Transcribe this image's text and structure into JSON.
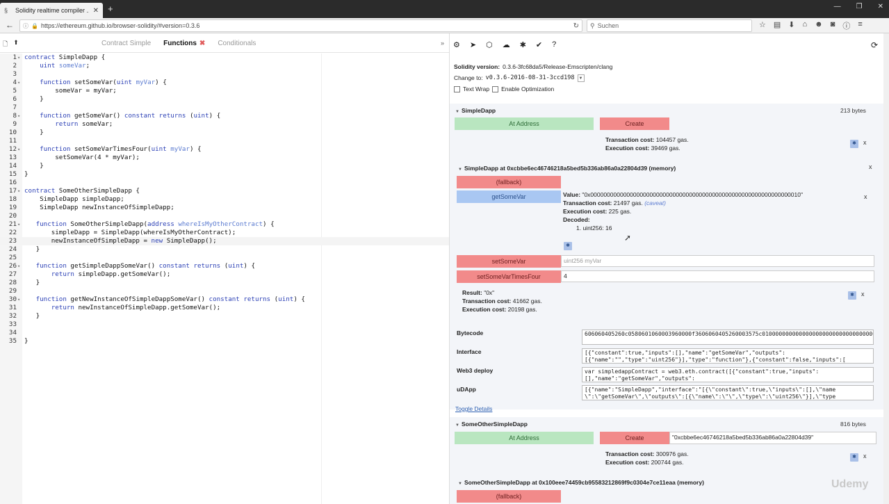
{
  "browser": {
    "tab_title": "Solidity realtime compiler ...",
    "url": "https://ethereum.github.io/browser-solidity/#version=0.3.6",
    "search_placeholder": "Suchen"
  },
  "editor": {
    "tabs": [
      {
        "label": "Contract Simple"
      },
      {
        "label": "Functions",
        "close": "✖"
      },
      {
        "label": "Conditionals"
      }
    ],
    "lines": [
      {
        "n": "1",
        "t": "contract SimpleDapp {"
      },
      {
        "n": "2",
        "t": "    uint someVar;"
      },
      {
        "n": "3",
        "t": ""
      },
      {
        "n": "4",
        "t": "    function setSomeVar(uint myVar) {"
      },
      {
        "n": "5",
        "t": "        someVar = myVar;"
      },
      {
        "n": "6",
        "t": "    }"
      },
      {
        "n": "7",
        "t": ""
      },
      {
        "n": "8",
        "t": "    function getSomeVar() constant returns (uint) {"
      },
      {
        "n": "9",
        "t": "        return someVar;"
      },
      {
        "n": "10",
        "t": "    }"
      },
      {
        "n": "11",
        "t": ""
      },
      {
        "n": "12",
        "t": "    function setSomeVarTimesFour(uint myVar) {"
      },
      {
        "n": "13",
        "t": "        setSomeVar(4 * myVar);"
      },
      {
        "n": "14",
        "t": "    }"
      },
      {
        "n": "15",
        "t": "}"
      },
      {
        "n": "16",
        "t": ""
      },
      {
        "n": "17",
        "t": "contract SomeOtherSimpleDapp {"
      },
      {
        "n": "18",
        "t": "    SimpleDapp simpleDapp;"
      },
      {
        "n": "19",
        "t": "    SimpleDapp newInstanceOfSimpleDapp;"
      },
      {
        "n": "20",
        "t": ""
      },
      {
        "n": "21",
        "t": "   function SomeOtherSimpleDapp(address whereIsMyOtherContract) {"
      },
      {
        "n": "22",
        "t": "       simpleDapp = SimpleDapp(whereIsMyOtherContract);"
      },
      {
        "n": "23",
        "t": "       newInstanceOfSimpleDapp = new SimpleDapp();"
      },
      {
        "n": "24",
        "t": "   }"
      },
      {
        "n": "25",
        "t": ""
      },
      {
        "n": "26",
        "t": "   function getSimpleDappSomeVar() constant returns (uint) {"
      },
      {
        "n": "27",
        "t": "       return simpleDapp.getSomeVar();"
      },
      {
        "n": "28",
        "t": "   }"
      },
      {
        "n": "29",
        "t": ""
      },
      {
        "n": "30",
        "t": "   function getNewInstanceOfSimpleDappSomeVar() constant returns (uint) {"
      },
      {
        "n": "31",
        "t": "       return newInstanceOfSimpleDapp.getSomeVar();"
      },
      {
        "n": "32",
        "t": "   }"
      },
      {
        "n": "33",
        "t": ""
      },
      {
        "n": "34",
        "t": ""
      },
      {
        "n": "35",
        "t": "}"
      }
    ]
  },
  "panel": {
    "solidity_version_label": "Solidity version:",
    "solidity_version": "0.3.6-3fc68da5/Release-Emscripten/clang",
    "change_to_label": "Change to:",
    "change_to_value": "v0.3.6-2016-08-31-3ccd198",
    "text_wrap": "Text Wrap",
    "enable_optimization": "Enable Optimization",
    "simpledapp": {
      "title": "SimpleDapp",
      "bytes": "213 bytes",
      "at_address": "At Address",
      "create": "Create",
      "tx_cost_label": "Transaction cost:",
      "tx_cost": "104457 gas.",
      "exec_cost_label": "Execution cost:",
      "exec_cost": "39469 gas."
    },
    "instance": {
      "title": "SimpleDapp at 0xcbbe6ec46746218a5bed5b336ab86a0a22804d39 (memory)",
      "fallback": "(fallback)",
      "getsomevar": "getSomeVar",
      "value_label": "Value:",
      "value": "\"0x0000000000000000000000000000000000000000000000000000000000000010\"",
      "tx_cost_label": "Transaction cost:",
      "tx_cost": "21497 gas.",
      "caveat": "(caveat)",
      "exec_cost_label": "Execution cost:",
      "exec_cost": "225 gas.",
      "decoded_label": "Decoded:",
      "decoded_value": "1. uint256: 16",
      "setsomevar": "setSomeVar",
      "setsomevar_placeholder": "uint256 myVar",
      "setsomevartimesfour": "setSomeVarTimesFour",
      "setsomevartimesfour_value": "4",
      "result_label": "Result:",
      "result": "\"0x\"",
      "tx2_cost": "41662 gas.",
      "exec2_cost": "20198 gas."
    },
    "details": {
      "bytecode_label": "Bytecode",
      "bytecode": "606060405260c0580601060003960000f3606060405260003575c01000000000000000000000000000000000000000000000000000000000000000000000000000000000000000000009004806304f03b6a14604b578063ce40689d14606c5780635",
      "interface_label": "Interface",
      "interface": "[{\"constant\":true,\"inputs\":[],\"name\":\"getSomeVar\",\"outputs\":\n[{\"name\":\"\",\"type\":\"uint256\"}],\"type\":\"function\"},{\"constant\":false,\"inputs\":[",
      "web3_label": "Web3 deploy",
      "web3": "var simpledappContract = web3.eth.contract([{\"constant\":true,\"inputs\":\n[],\"name\":\"getSomeVar\",\"outputs\":",
      "udapp_label": "uDApp",
      "udapp": "[{\"name\":\"SimpleDapp\",\"interface\":\"[{\\\"constant\\\":true,\\\"inputs\\\":[],\\\"name\n\\\":\\\"getSomeVar\\\",\\\"outputs\\\":[{\\\"name\\\":\\\"\\\",\\\"type\\\":\\\"uint256\\\"}],\\\"type",
      "toggle": "Toggle Details"
    },
    "other": {
      "title": "SomeOtherSimpleDapp",
      "bytes": "816 bytes",
      "at_address": "At Address",
      "create": "Create",
      "create_arg": "\"0xcbbe6ec46746218a5bed5b336ab86a0a22804d39\"",
      "tx_cost_label": "Transaction cost:",
      "tx_cost": "300976 gas.",
      "exec_cost_label": "Execution cost:",
      "exec_cost": "200744 gas."
    },
    "other_instance": {
      "title": "SomeOtherSimpleDapp at 0x100eee74459cb95583212869f9c0304e7ce11eaa (memory)",
      "fallback": "(fallback)"
    }
  },
  "watermark": "Udemy"
}
